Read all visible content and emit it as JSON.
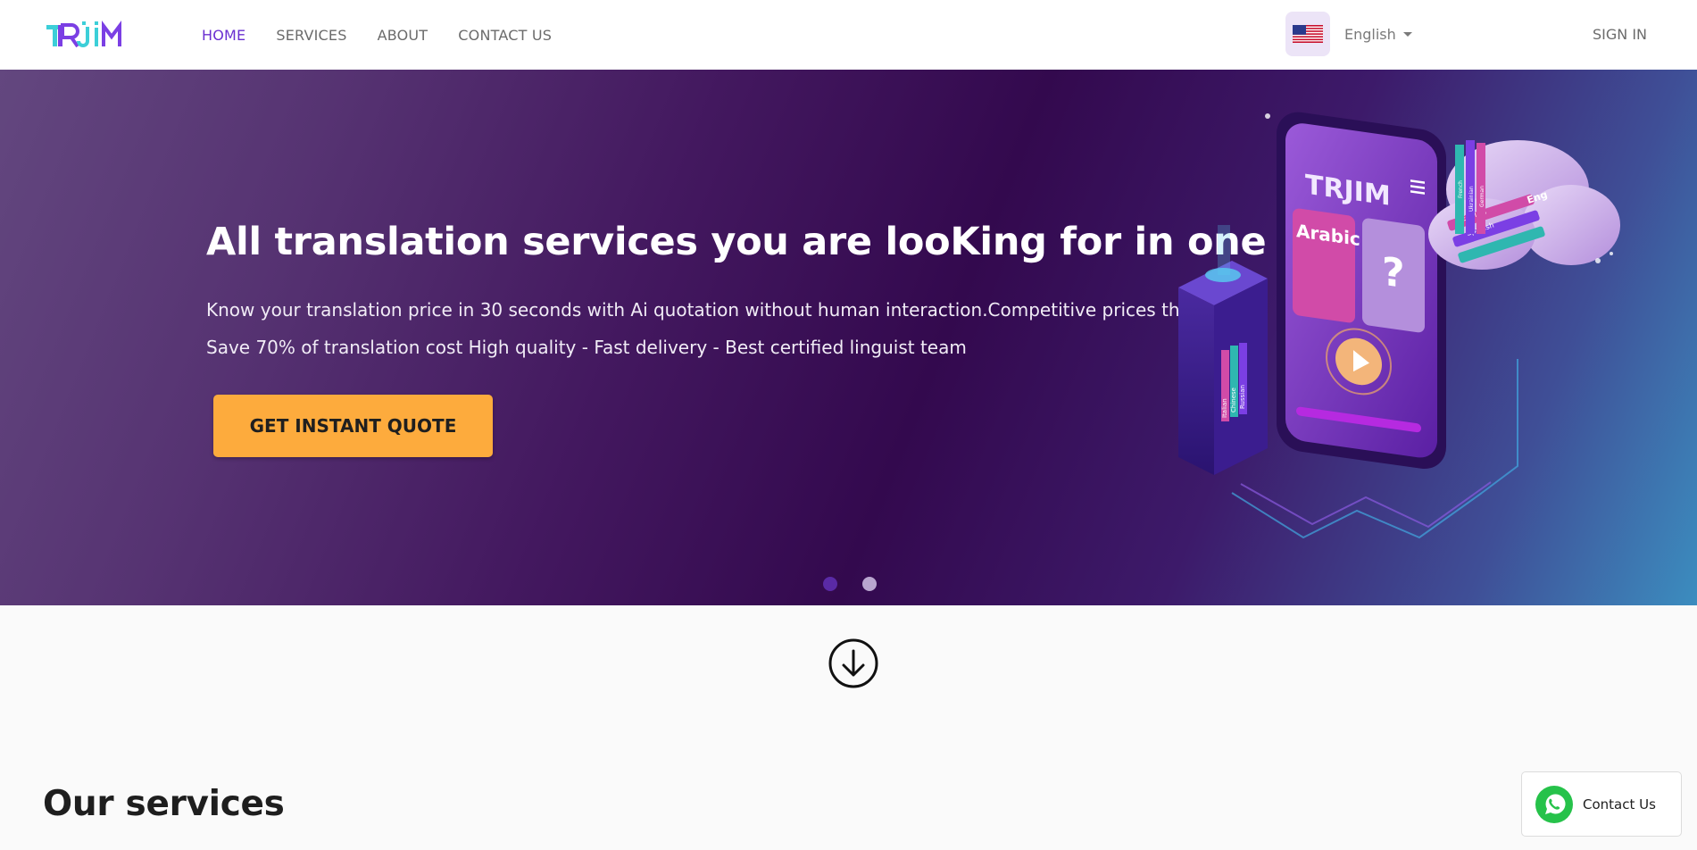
{
  "brand": {
    "logo_text": "TRJIM",
    "colors": {
      "logo_cyan": "#3ccfd8",
      "logo_purple": "#7b3fe4",
      "accent": "#6a2fd1",
      "cta": "#fdab3d"
    }
  },
  "nav": {
    "items": [
      {
        "label": "HOME",
        "active": true
      },
      {
        "label": "SERVICES",
        "active": false
      },
      {
        "label": "ABOUT",
        "active": false
      },
      {
        "label": "CONTACT US",
        "active": false
      }
    ],
    "language": {
      "flag_icon": "us-flag-icon",
      "selected": "English"
    },
    "sign_in": "SIGN IN"
  },
  "hero": {
    "title": "All translation services you are looKing for in one place",
    "subtitle": "Know your translation price in 30 seconds with Ai quotation without human interaction.Competitive prices that Save 70% of translation cost High quality - Fast delivery - Best certified linguist team",
    "cta": "GET INSTANT QUOTE",
    "slides": {
      "count": 2,
      "active_index": 0
    },
    "illustration": {
      "phone_logo": "TRJIM",
      "card_left": "Arabic",
      "card_right": "?",
      "books": [
        "Italian",
        "Chinese",
        "Russian"
      ],
      "cloud_books": [
        "English",
        "Spanish",
        "Eng"
      ],
      "side_books": [
        "French",
        "Ukrainian",
        "German"
      ]
    }
  },
  "scroll_icon": "arrow-down-circle-icon",
  "services": {
    "title": "Our services"
  },
  "contact_widget": {
    "icon": "whatsapp-icon",
    "label": "Contact Us"
  }
}
